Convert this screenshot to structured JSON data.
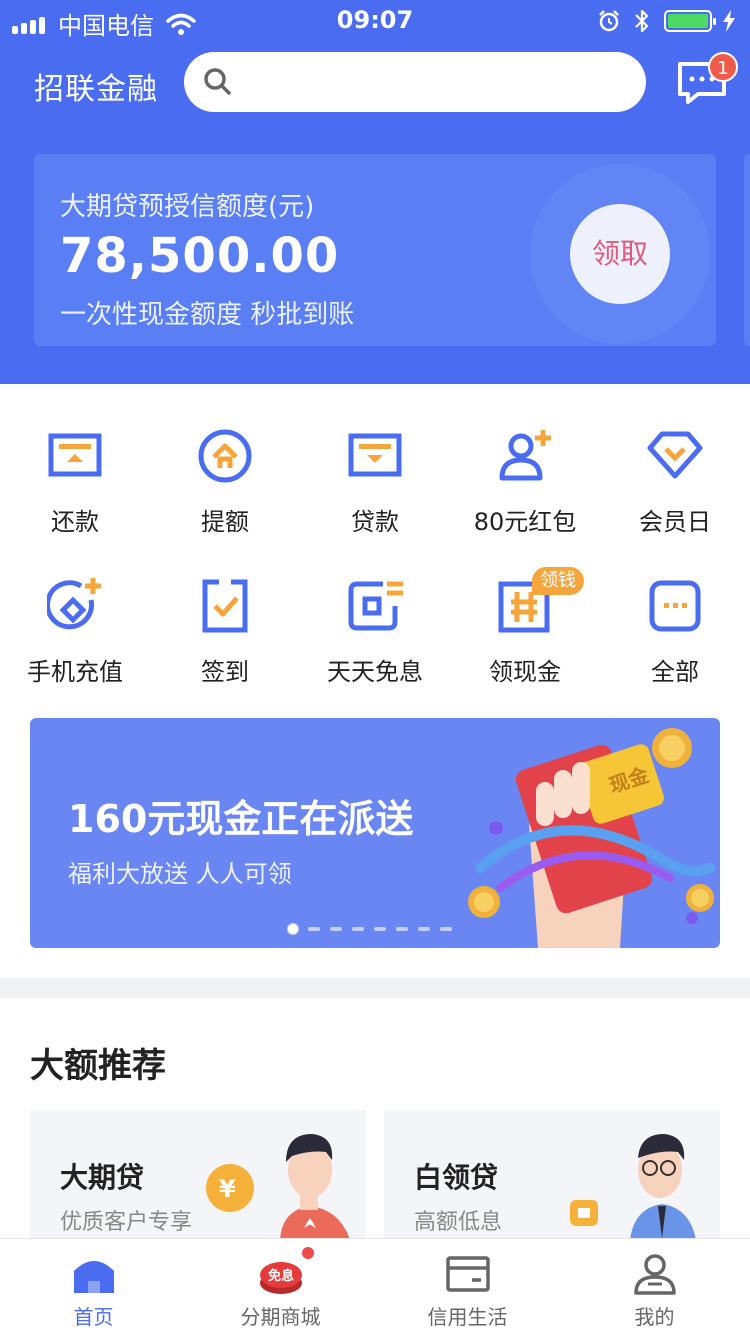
{
  "status_bar": {
    "carrier": "中国电信",
    "time": "09:07"
  },
  "header": {
    "brand": "招联金融",
    "search_placeholder": "",
    "message_badge": "1"
  },
  "credit_card": {
    "label": "大期贷预授信额度(元)",
    "amount": "78,500.00",
    "subtitle": "一次性现金额度 秒批到账",
    "claim_label": "领取"
  },
  "grid": {
    "items": [
      {
        "label": "还款",
        "icon": "repay-icon"
      },
      {
        "label": "提额",
        "icon": "raise-limit-icon"
      },
      {
        "label": "贷款",
        "icon": "loan-icon"
      },
      {
        "label": "80元红包",
        "icon": "add-friend-icon"
      },
      {
        "label": "会员日",
        "icon": "diamond-icon"
      },
      {
        "label": "手机充值",
        "icon": "phone-recharge-icon"
      },
      {
        "label": "签到",
        "icon": "checkin-icon"
      },
      {
        "label": "天天免息",
        "icon": "interest-free-icon"
      },
      {
        "label": "领现金",
        "icon": "cash-icon"
      },
      {
        "label": "全部",
        "icon": "more-icon"
      }
    ],
    "cash_badge": "领钱"
  },
  "banner": {
    "title": "160元现金正在派送",
    "subtitle": "福利大放送 人人可领",
    "coin_text": "现金",
    "pages": 8,
    "active_page": 1
  },
  "recommend": {
    "title": "大额推荐",
    "cards": [
      {
        "name": "大期贷",
        "desc": "优质客户专享"
      },
      {
        "name": "白领贷",
        "desc": "高额低息"
      }
    ]
  },
  "tabbar": {
    "tabs": [
      {
        "label": "首页",
        "icon": "home-icon",
        "active": true
      },
      {
        "label": "分期商城",
        "icon": "mall-icon",
        "badge": "免息"
      },
      {
        "label": "信用生活",
        "icon": "card-icon"
      },
      {
        "label": "我的",
        "icon": "profile-icon"
      }
    ]
  },
  "colors": {
    "primary": "#4a6cf0",
    "accent": "#f5a53c",
    "claim_text": "#e05a7a",
    "badge": "#f05a4a"
  }
}
